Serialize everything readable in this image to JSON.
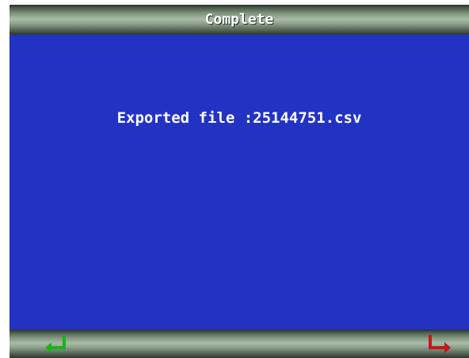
{
  "window": {
    "title": "Complete"
  },
  "main": {
    "message": "Exported file :25144751.csv"
  },
  "footer": {
    "left_icon": "enter-icon",
    "right_icon": "back-icon"
  },
  "colors": {
    "background": "#2233c4",
    "title_bar": "#8fa38f",
    "enter_icon": "#18b418",
    "back_icon": "#c41818",
    "text": "#ffffff"
  }
}
